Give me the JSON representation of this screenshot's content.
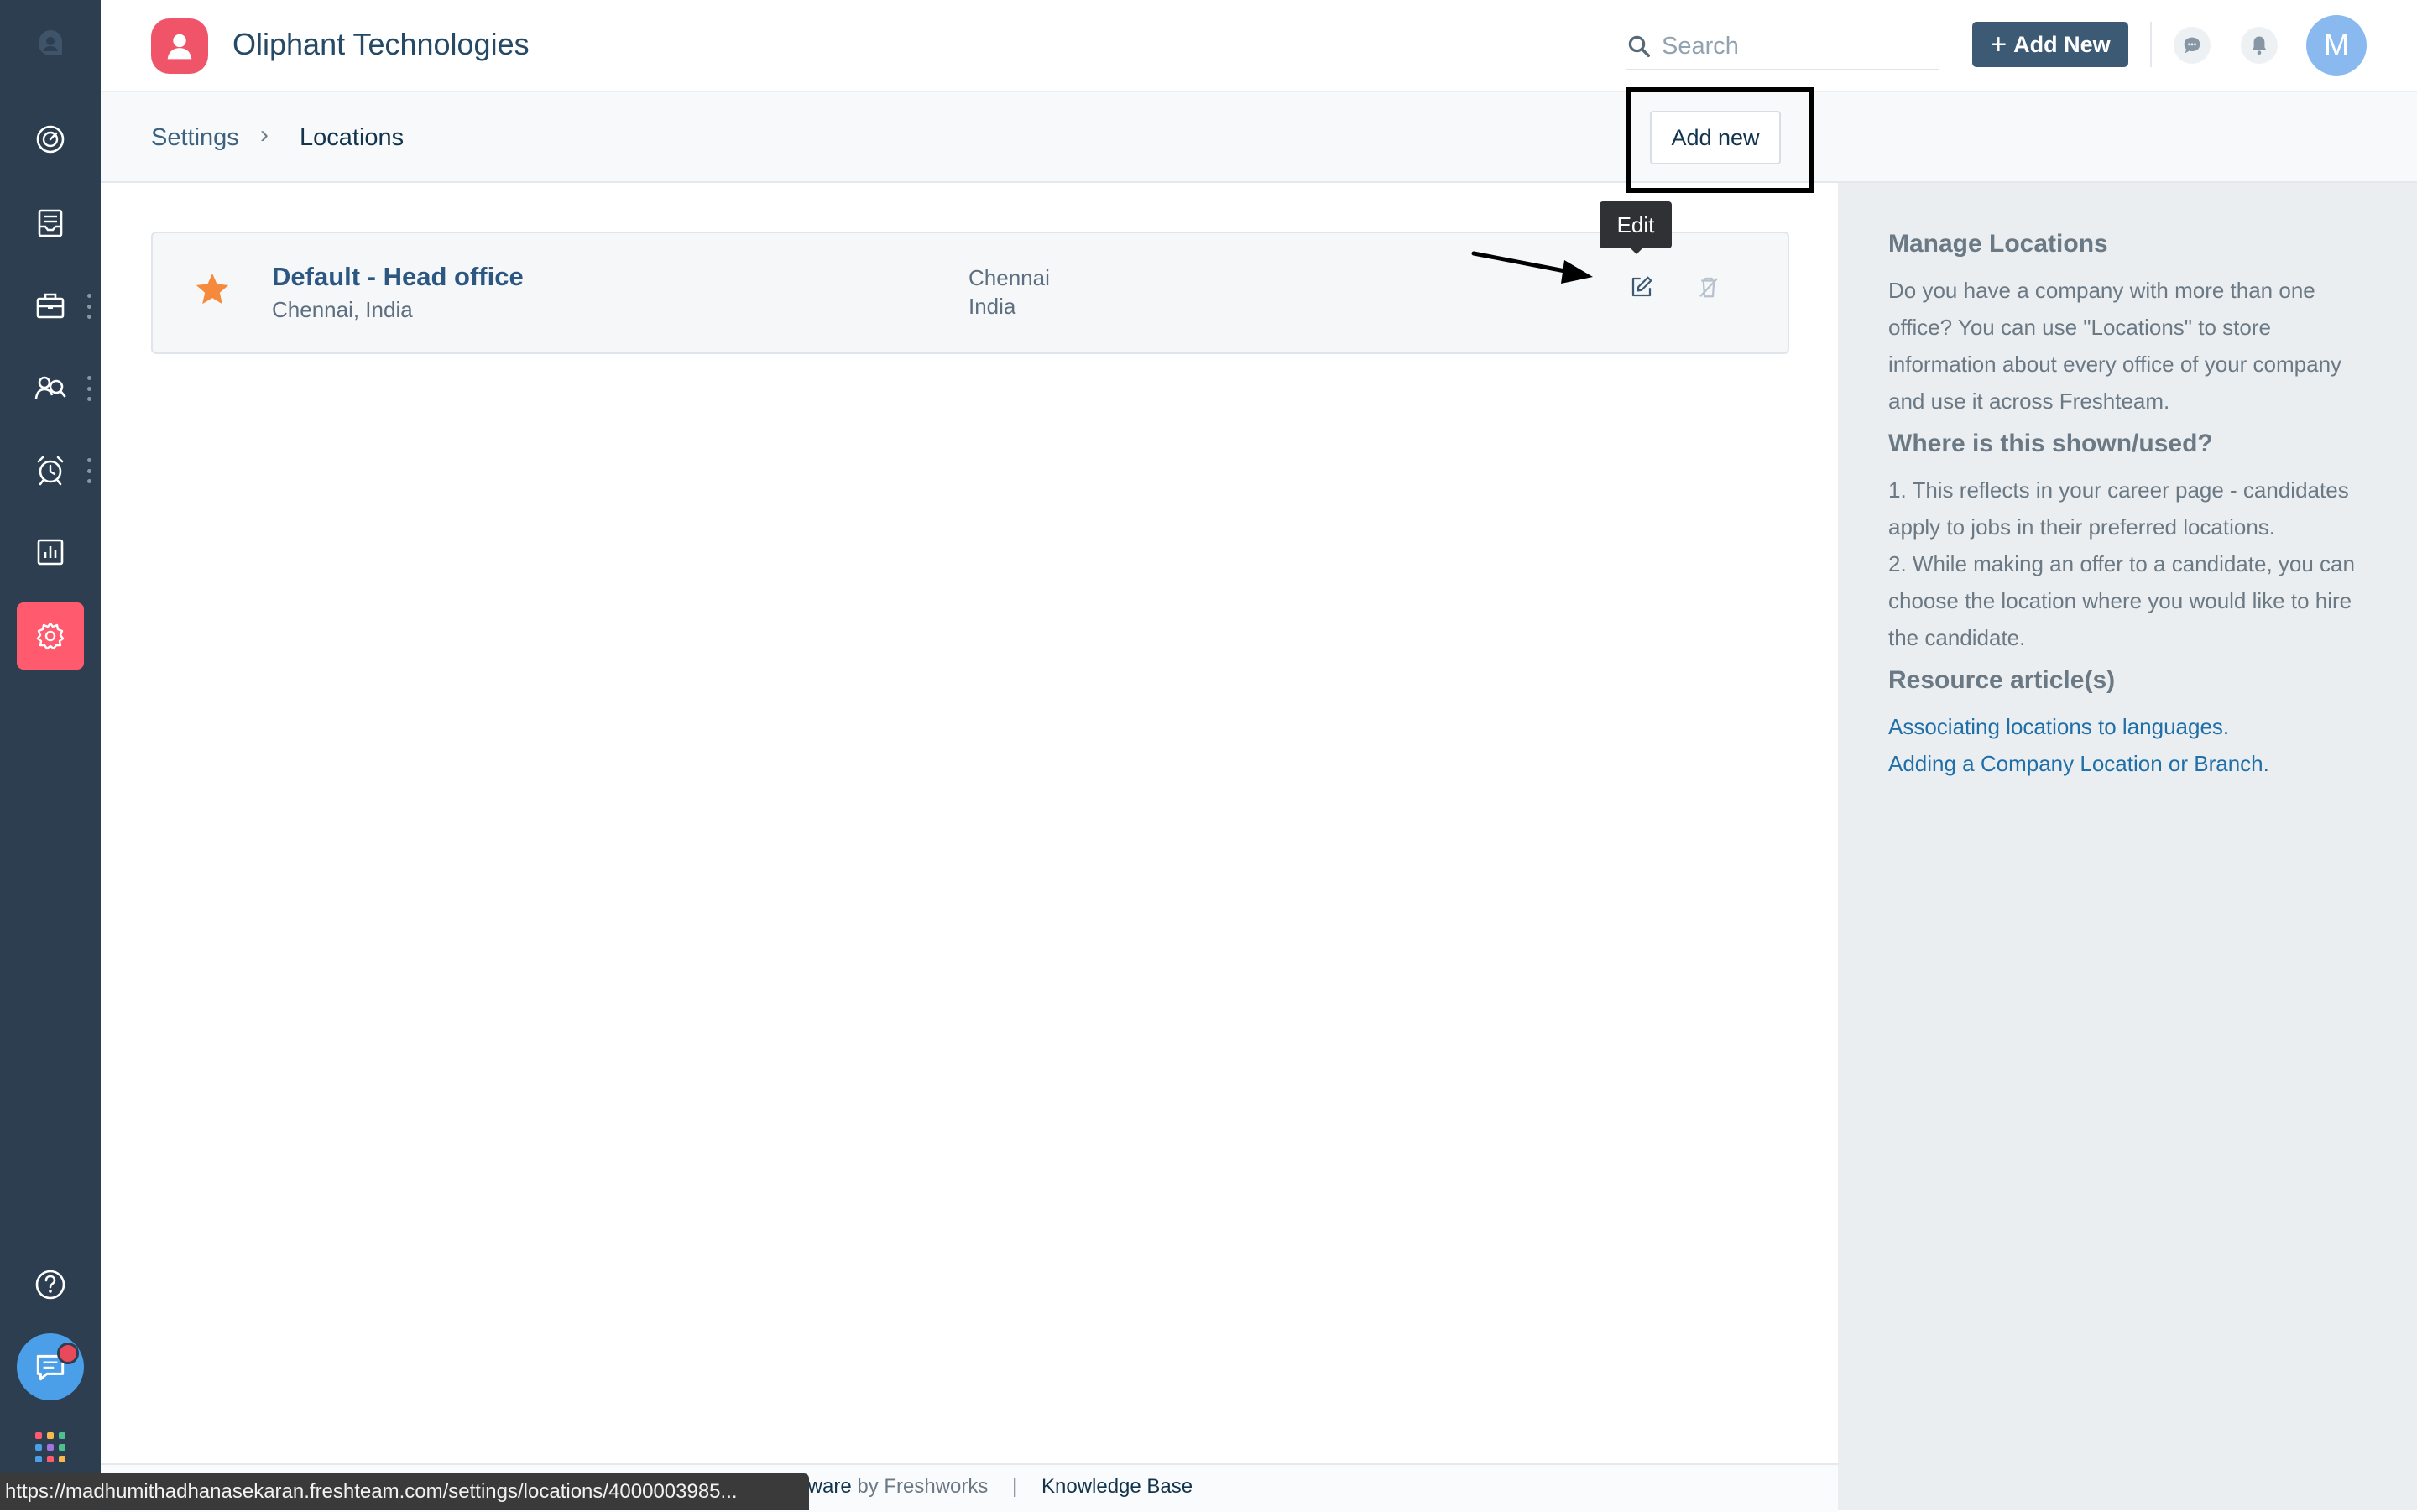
{
  "app": {
    "company_name": "Oliphant Technologies"
  },
  "header": {
    "search_placeholder": "Search",
    "add_new_label": "Add New",
    "add_new_plus": "+",
    "avatar_initial": "M"
  },
  "sidebar": {
    "items": [
      {
        "icon": "logo-avatar-icon"
      },
      {
        "icon": "dashboard-gauge-icon"
      },
      {
        "icon": "inbox-tray-icon"
      },
      {
        "icon": "briefcase-icon"
      },
      {
        "icon": "people-search-icon"
      },
      {
        "icon": "alarm-clock-icon"
      },
      {
        "icon": "reports-chart-icon"
      },
      {
        "icon": "settings-gear-icon",
        "active": true
      },
      {
        "icon": "help-icon"
      },
      {
        "icon": "chat-icon"
      },
      {
        "icon": "apps-grid-icon"
      }
    ],
    "apps_grid_colors": [
      "#ff5a6e",
      "#f8b94c",
      "#4ac18e",
      "#4a9fe8",
      "#a374e0",
      "#4ac18e",
      "#4a9fe8",
      "#ff5a6e",
      "#f8b94c"
    ]
  },
  "breadcrumb": {
    "parent": "Settings",
    "separator": "›",
    "current": "Locations"
  },
  "page_actions": {
    "add_new_label": "Add new"
  },
  "locations": [
    {
      "name": "Default - Head office",
      "subtitle": "Chennai, India",
      "city": "Chennai",
      "country": "India",
      "is_default": true
    }
  ],
  "tooltip": {
    "text": "Edit"
  },
  "right_panel": {
    "title": "Manage Locations",
    "intro": "Do you have a company with more than one office? You can use \"Locations\" to store information about every office of your company and use it across Freshteam.",
    "where_title": "Where is this shown/used?",
    "point_1": "1. This reflects in your career page - candidates apply to jobs in their preferred locations.",
    "point_2": "2. While making an offer to a candidate, you can choose the location where you would like to hire the candidate.",
    "resources_title": "Resource article(s)",
    "link_1": "Associating locations to languages.",
    "link_2": "Adding a Company Location or Branch."
  },
  "footer": {
    "software_text": "tware",
    "by_text": "by Freshworks",
    "separator": "|",
    "knowledge_base": "Knowledge Base"
  },
  "status_bar": {
    "url": "https://madhumithadhanasekaran.freshteam.com/settings/locations/4000003985..."
  },
  "colors": {
    "sidebar_bg": "#2c3e50",
    "accent": "#ff5a6e",
    "primary_button": "#3d5a75",
    "star": "#f58a3c",
    "link": "#1f6fa8"
  }
}
